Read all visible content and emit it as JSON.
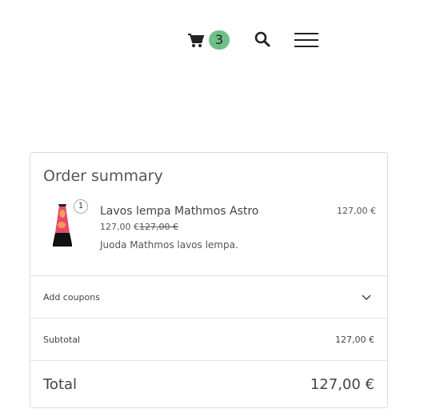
{
  "header": {
    "cart_count": "3",
    "cart_icon": "shopping-cart-icon",
    "search_icon": "search-icon",
    "menu_icon": "hamburger-menu-icon",
    "badge_color": "#6fbf87"
  },
  "summary": {
    "title": "Order summary",
    "item": {
      "quantity": "1",
      "name": "Lavos lempa Mathmos Astro",
      "price": "127,00 €",
      "original_price": "127,00 €",
      "description": "Juoda Mathmos lavos lempa.",
      "line_total": "127,00 €",
      "image_icon": "lava-lamp-image"
    },
    "coupons_label": "Add coupons",
    "subtotal_label": "Subtotal",
    "subtotal_value": "127,00 €",
    "total_label": "Total",
    "total_value": "127,00 €"
  }
}
